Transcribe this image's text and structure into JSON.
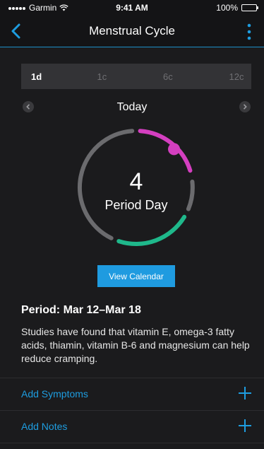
{
  "status_bar": {
    "carrier": "Garmin",
    "time": "9:41 AM",
    "battery": "100%",
    "battery_level": 1.0
  },
  "nav": {
    "title": "Menstrual Cycle",
    "back_icon": "chevron-left-icon",
    "more_icon": "vertical-ellipsis-icon"
  },
  "segments": [
    {
      "label": "1d",
      "active": true
    },
    {
      "label": "1c",
      "active": false
    },
    {
      "label": "6c",
      "active": false
    },
    {
      "label": "12c",
      "active": false
    }
  ],
  "date_nav": {
    "label": "Today",
    "prev_icon": "chevron-left-icon",
    "next_icon": "chevron-right-icon"
  },
  "cycle_ring": {
    "day_number": "4",
    "day_label": "Period Day",
    "colors": {
      "cycle": "#6b6b6e",
      "period": "#d43fc0",
      "fertile": "#1fb88b"
    }
  },
  "view_calendar_label": "View Calendar",
  "period": {
    "title": "Period: Mar 12–Mar 18",
    "description": "Studies have found that vitamin E, omega-3 fatty acids, thiamin, vitamin B-6 and magnesium can help reduce cramping."
  },
  "actions": [
    {
      "label": "Add Symptoms",
      "icon": "plus-icon"
    },
    {
      "label": "Add Notes",
      "icon": "plus-icon"
    }
  ],
  "colors": {
    "accent": "#1e9de0",
    "background": "#1b1b1d"
  }
}
